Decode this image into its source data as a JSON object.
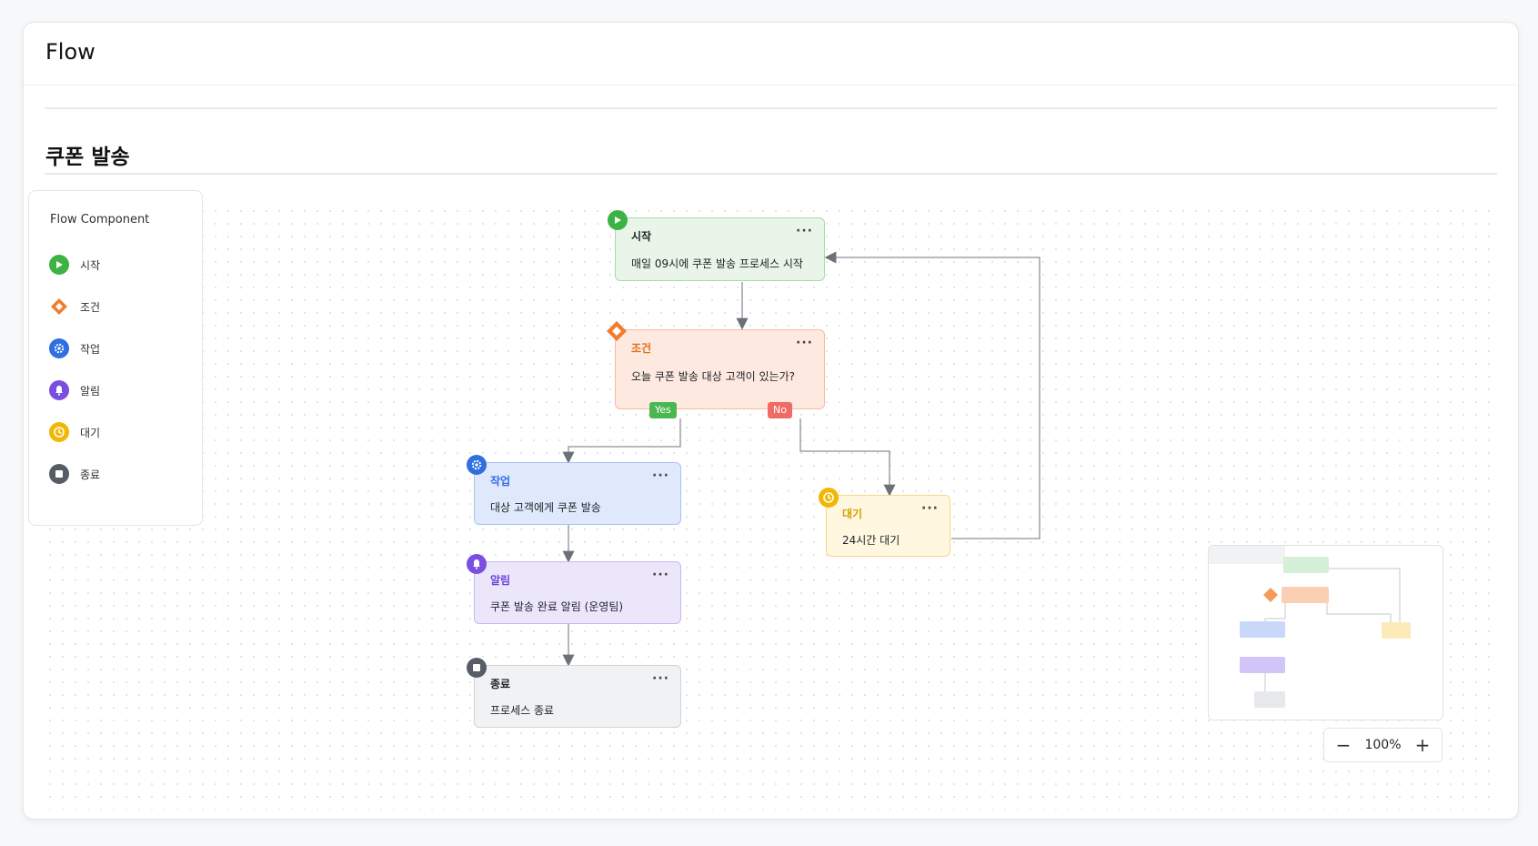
{
  "window": {
    "title": "Flow"
  },
  "flow": {
    "title": "쿠폰 발송"
  },
  "legend": {
    "title": "Flow Component",
    "items": [
      {
        "label": "시작",
        "icon": "play-icon",
        "color": "#3db344"
      },
      {
        "label": "조건",
        "icon": "diamond-icon",
        "color": "#f07d2b"
      },
      {
        "label": "작업",
        "icon": "gear-icon",
        "color": "#2f6fe0"
      },
      {
        "label": "알림",
        "icon": "bell-icon",
        "color": "#7a4ee0"
      },
      {
        "label": "대기",
        "icon": "clock-icon",
        "color": "#f2b705"
      },
      {
        "label": "종료",
        "icon": "stop-icon",
        "color": "#575d66"
      }
    ]
  },
  "nodes": {
    "start": {
      "type": "시작",
      "desc": "매일 09시에 쿠폰 발송 프로세스 시작",
      "icon": "play-icon"
    },
    "cond": {
      "type": "조건",
      "desc": "오늘 쿠폰 발송 대상 고객이 있는가?",
      "icon": "diamond-icon"
    },
    "task": {
      "type": "작업",
      "desc": "대상 고객에게 쿠폰 발송",
      "icon": "gear-icon"
    },
    "notify": {
      "type": "알림",
      "desc": "쿠폰 발송 완료 알림 (운영팀)",
      "icon": "bell-icon"
    },
    "end": {
      "type": "종료",
      "desc": "프로세스 종료",
      "icon": "stop-icon"
    },
    "wait": {
      "type": "대기",
      "desc": "24시간 대기",
      "icon": "clock-icon"
    }
  },
  "branches": {
    "yes": "Yes",
    "no": "No"
  },
  "node_menu": "···",
  "zoom": {
    "value": "100%",
    "minus": "−",
    "plus": "+"
  }
}
